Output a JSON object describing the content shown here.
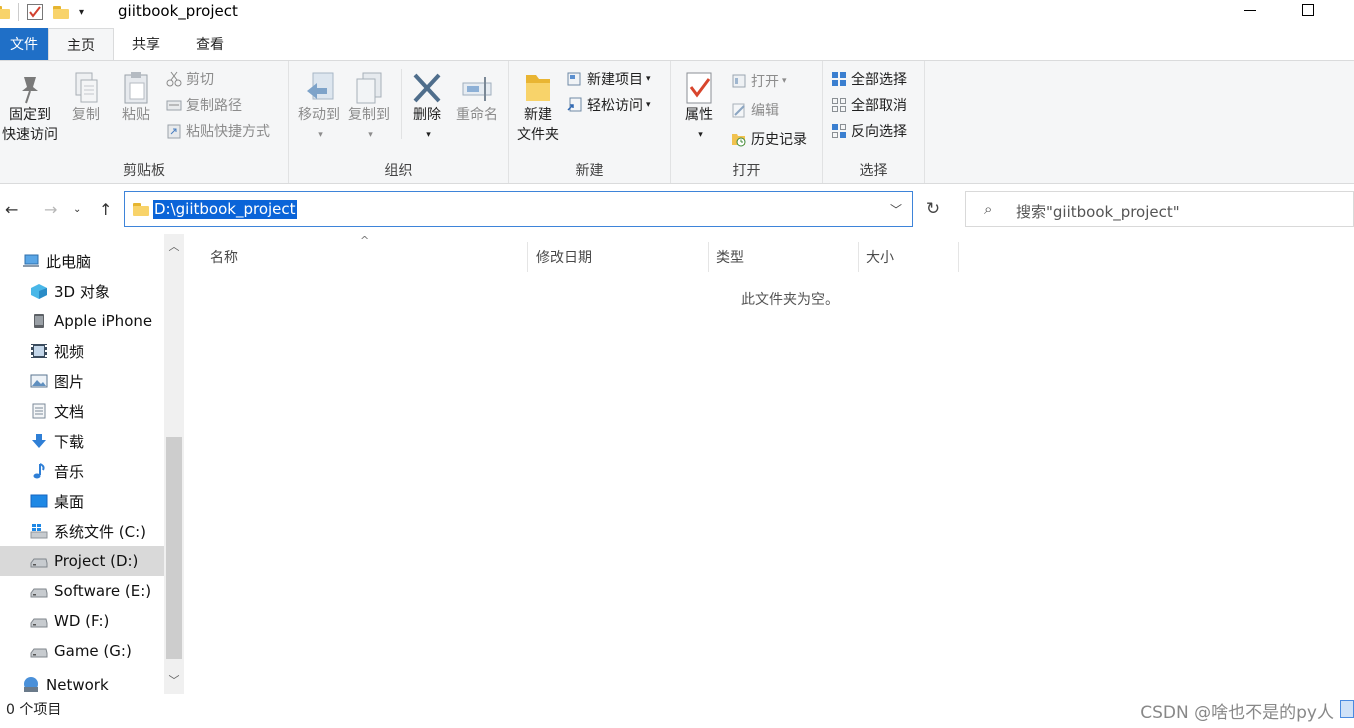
{
  "window": {
    "title": "giitbook_project"
  },
  "ribbon_tabs": [
    {
      "label": "文件"
    },
    {
      "label": "主页"
    },
    {
      "label": "共享"
    },
    {
      "label": "查看"
    }
  ],
  "ribbon": {
    "clipboard": {
      "label": "剪贴板",
      "pin_line1": "固定到",
      "pin_line2": "快速访问",
      "copy": "复制",
      "paste": "粘贴",
      "cut": "剪切",
      "copy_path": "复制路径",
      "paste_shortcut": "粘贴快捷方式"
    },
    "organize": {
      "label": "组织",
      "move_to": "移动到",
      "copy_to": "复制到",
      "delete": "删除",
      "rename": "重命名"
    },
    "new": {
      "label": "新建",
      "new_folder_line1": "新建",
      "new_folder_line2": "文件夹",
      "new_item": "新建项目",
      "easy_access": "轻松访问"
    },
    "open": {
      "label": "打开",
      "properties": "属性",
      "open": "打开",
      "edit": "编辑",
      "history": "历史记录"
    },
    "select": {
      "label": "选择",
      "select_all": "全部选择",
      "select_none": "全部取消",
      "invert": "反向选择"
    }
  },
  "address": {
    "path": "D:\\giitbook_project"
  },
  "search": {
    "placeholder": "搜索\"giitbook_project\""
  },
  "nav": {
    "items": [
      {
        "label": "此电脑",
        "icon": "computer-icon"
      },
      {
        "label": "3D 对象",
        "icon": "3d-objects-icon"
      },
      {
        "label": "Apple iPhone",
        "icon": "phone-icon"
      },
      {
        "label": "视频",
        "icon": "video-icon"
      },
      {
        "label": "图片",
        "icon": "pictures-icon"
      },
      {
        "label": "文档",
        "icon": "documents-icon"
      },
      {
        "label": "下载",
        "icon": "download-icon"
      },
      {
        "label": "音乐",
        "icon": "music-icon"
      },
      {
        "label": "桌面",
        "icon": "desktop-icon"
      },
      {
        "label": "系统文件 (C:)",
        "icon": "system-drive-icon"
      },
      {
        "label": "Project (D:)",
        "icon": "drive-icon"
      },
      {
        "label": "Software (E:)",
        "icon": "drive-icon"
      },
      {
        "label": "WD (F:)",
        "icon": "drive-icon"
      },
      {
        "label": "Game (G:)",
        "icon": "drive-icon"
      },
      {
        "label": "Network",
        "icon": "network-icon"
      }
    ]
  },
  "columns": [
    {
      "label": "名称"
    },
    {
      "label": "修改日期"
    },
    {
      "label": "类型"
    },
    {
      "label": "大小"
    }
  ],
  "content": {
    "empty_message": "此文件夹为空。"
  },
  "status": {
    "item_count": "0 个项目",
    "watermark": "CSDN @啥也不是的py人"
  },
  "colors": {
    "accent": "#1f6fc7",
    "selection": "#0a64d8",
    "ribbon_bg": "#f5f6f7"
  }
}
